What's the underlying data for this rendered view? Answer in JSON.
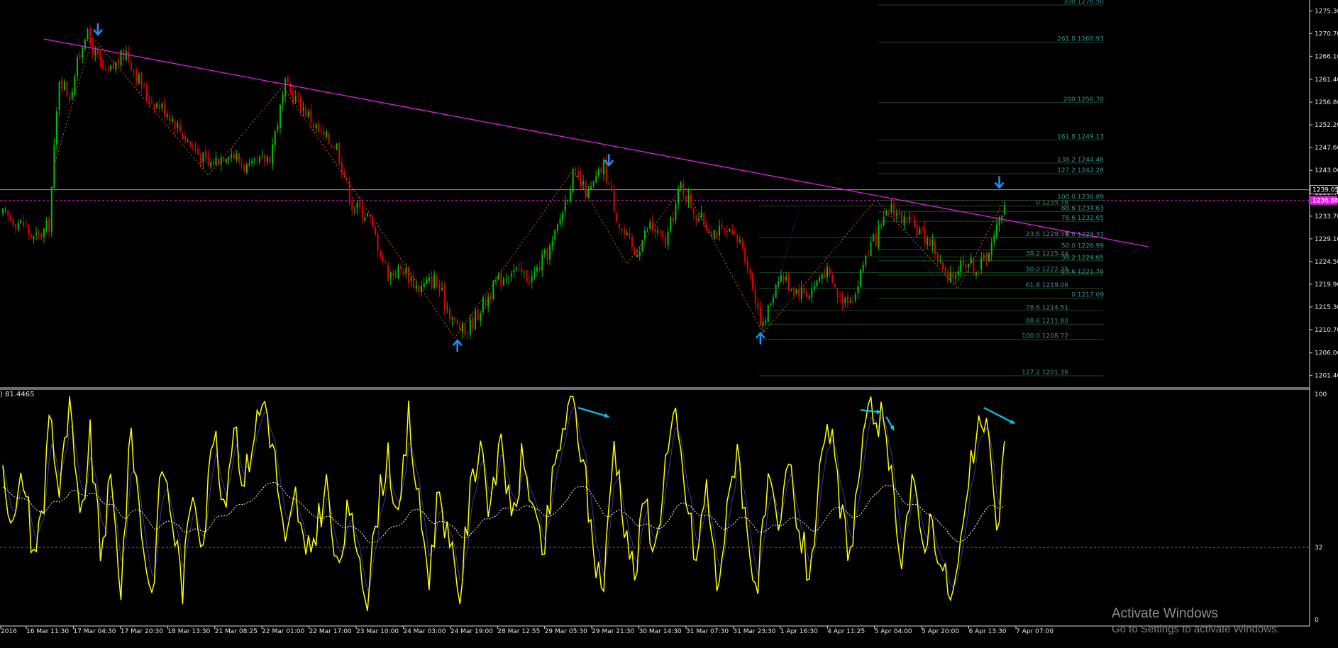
{
  "chart_data": {
    "type": "candlestick",
    "title": "",
    "price_axis": {
      "ticks": [
        "1275.30",
        "1270.70",
        "1266.10",
        "1261.40",
        "1256.80",
        "1252.20",
        "1247.60",
        "1243.00",
        "1238.40",
        "1233.70",
        "1229.10",
        "1224.50",
        "1219.90",
        "1215.30",
        "1210.70",
        "1206.00",
        "1201.40"
      ],
      "ylim": [
        1199.2,
        1277.5
      ],
      "current_price": "1239.05",
      "bid_marker": "1236.88",
      "bid_line": 1236.88,
      "current_line": 1239.05
    },
    "time_axis": {
      "labels": [
        "2016",
        "16 Mar 11:30",
        "17 Mar 04:30",
        "17 Mar 20:30",
        "18 Mar 13:30",
        "21 Mar 08:25",
        "22 Mar 01:00",
        "22 Mar 17:00",
        "23 Mar 10:00",
        "24 Mar 03:00",
        "24 Mar 19:00",
        "28 Mar 12:55",
        "29 Mar 05:30",
        "29 Mar 21:30",
        "30 Mar 14:30",
        "31 Mar 07:30",
        "31 Mar 23:30",
        "1 Apr 16:30",
        "4 Apr 11:25",
        "5 Apr 04:00",
        "5 Apr 20:00",
        "6 Apr 13:30",
        "7 Apr 07:00"
      ]
    },
    "price_swings": [
      {
        "i": 0,
        "p": 1234
      },
      {
        "i": 8,
        "p": 1232
      },
      {
        "i": 12,
        "p": 1229
      },
      {
        "i": 15,
        "p": 1230
      },
      {
        "i": 18,
        "p": 1232
      },
      {
        "i": 22,
        "p": 1262
      },
      {
        "i": 26,
        "p": 1258
      },
      {
        "i": 32,
        "p": 1271
      },
      {
        "i": 40,
        "p": 1262
      },
      {
        "i": 48,
        "p": 1267
      },
      {
        "i": 56,
        "p": 1258
      },
      {
        "i": 64,
        "p": 1255
      },
      {
        "i": 72,
        "p": 1249
      },
      {
        "i": 80,
        "p": 1244
      },
      {
        "i": 88,
        "p": 1247
      },
      {
        "i": 96,
        "p": 1243
      },
      {
        "i": 104,
        "p": 1246
      },
      {
        "i": 110,
        "p": 1260
      },
      {
        "i": 118,
        "p": 1255
      },
      {
        "i": 124,
        "p": 1250
      },
      {
        "i": 130,
        "p": 1248
      },
      {
        "i": 136,
        "p": 1236
      },
      {
        "i": 142,
        "p": 1234
      },
      {
        "i": 150,
        "p": 1222
      },
      {
        "i": 156,
        "p": 1223
      },
      {
        "i": 162,
        "p": 1219
      },
      {
        "i": 168,
        "p": 1221
      },
      {
        "i": 176,
        "p": 1212
      },
      {
        "i": 180,
        "p": 1210
      },
      {
        "i": 186,
        "p": 1215
      },
      {
        "i": 192,
        "p": 1220
      },
      {
        "i": 198,
        "p": 1223
      },
      {
        "i": 206,
        "p": 1221
      },
      {
        "i": 214,
        "p": 1228
      },
      {
        "i": 222,
        "p": 1242
      },
      {
        "i": 228,
        "p": 1238
      },
      {
        "i": 234,
        "p": 1244
      },
      {
        "i": 240,
        "p": 1232
      },
      {
        "i": 246,
        "p": 1226
      },
      {
        "i": 252,
        "p": 1232
      },
      {
        "i": 258,
        "p": 1228
      },
      {
        "i": 264,
        "p": 1240
      },
      {
        "i": 270,
        "p": 1234
      },
      {
        "i": 276,
        "p": 1231
      },
      {
        "i": 282,
        "p": 1230
      },
      {
        "i": 288,
        "p": 1228
      },
      {
        "i": 296,
        "p": 1211
      },
      {
        "i": 302,
        "p": 1222
      },
      {
        "i": 308,
        "p": 1219
      },
      {
        "i": 314,
        "p": 1218
      },
      {
        "i": 320,
        "p": 1223
      },
      {
        "i": 326,
        "p": 1217
      },
      {
        "i": 332,
        "p": 1218
      },
      {
        "i": 336,
        "p": 1226
      },
      {
        "i": 342,
        "p": 1231
      },
      {
        "i": 346,
        "p": 1236
      },
      {
        "i": 350,
        "p": 1233
      },
      {
        "i": 356,
        "p": 1231
      },
      {
        "i": 362,
        "p": 1228
      },
      {
        "i": 368,
        "p": 1220
      },
      {
        "i": 374,
        "p": 1225
      },
      {
        "i": 380,
        "p": 1223
      },
      {
        "i": 386,
        "p": 1229
      },
      {
        "i": 390,
        "p": 1237
      }
    ],
    "bar_count": 391,
    "trendline": {
      "from": {
        "i": 16,
        "p": 1269.6
      },
      "to": {
        "i": 446,
        "p": 1227.5
      },
      "color": "#e020e0"
    },
    "zigzag": [
      {
        "i": 20,
        "p": 1244
      },
      {
        "i": 35,
        "p": 1270
      },
      {
        "i": 80,
        "p": 1242
      },
      {
        "i": 109,
        "p": 1260
      },
      {
        "i": 176,
        "p": 1209
      },
      {
        "i": 222,
        "p": 1243
      },
      {
        "i": 243,
        "p": 1224
      },
      {
        "i": 265,
        "p": 1240
      },
      {
        "i": 296,
        "p": 1210
      },
      {
        "i": 340,
        "p": 1237
      },
      {
        "i": 372,
        "p": 1219
      },
      {
        "i": 390,
        "p": 1237
      }
    ],
    "arrows": [
      {
        "i": 37,
        "p": 1271.5,
        "dir": "down"
      },
      {
        "i": 177,
        "p": 1207.5,
        "dir": "up"
      },
      {
        "i": 236,
        "p": 1245,
        "dir": "down"
      },
      {
        "i": 295,
        "p": 1209,
        "dir": "up"
      },
      {
        "i": 388,
        "p": 1240.5,
        "dir": "down"
      }
    ],
    "fib_set_a": [
      {
        "label": "100.0  1208.72",
        "p": 1208.72
      },
      {
        "label": "88.6  1211.80",
        "p": 1211.8
      },
      {
        "label": "78.6  1214.51",
        "p": 1214.51
      },
      {
        "label": "61.8  1219.06",
        "p": 1219.06
      },
      {
        "label": "50.0  1222.25",
        "p": 1222.25
      },
      {
        "label": "38.2  1225.44",
        "p": 1225.44
      },
      {
        "label": "23.6  1229.39",
        "p": 1229.39
      },
      {
        "label": "0  1235.78",
        "p": 1235.78
      },
      {
        "label": "127.2  1201.36",
        "p": 1201.36
      }
    ],
    "fib_set_b": [
      {
        "label": "300  1276.50",
        "p": 1276.5
      },
      {
        "label": "261.8  1268.93",
        "p": 1268.93
      },
      {
        "label": "200  1256.70",
        "p": 1256.7
      },
      {
        "label": "161.8  1249.13",
        "p": 1249.13
      },
      {
        "label": "138.2  1244.46",
        "p": 1244.46
      },
      {
        "label": "127.2  1242.28",
        "p": 1242.28
      },
      {
        "label": "100.0  1236.89",
        "p": 1236.89
      },
      {
        "label": "88.6  1234.63",
        "p": 1234.63
      },
      {
        "label": "78.6  1232.65",
        "p": 1232.65
      },
      {
        "label": "8.6  1229.33",
        "p": 1229.33
      },
      {
        "label": "50.0  1226.99",
        "p": 1226.99
      },
      {
        "label": "38.2  1224.65",
        "p": 1224.65
      },
      {
        "label": "23.6  1221.76",
        "p": 1221.76
      },
      {
        "label": "0  1217.09",
        "p": 1217.09
      }
    ],
    "oscillator": {
      "label": ") 81.4465",
      "ylim": [
        0,
        100
      ],
      "ticks": [
        "100",
        "32",
        "0"
      ],
      "level_line": 32,
      "swings": [
        {
          "i": 0,
          "v": 70
        },
        {
          "i": 4,
          "v": 40
        },
        {
          "i": 8,
          "v": 65
        },
        {
          "i": 12,
          "v": 30
        },
        {
          "i": 16,
          "v": 50
        },
        {
          "i": 18,
          "v": 97
        },
        {
          "i": 22,
          "v": 55
        },
        {
          "i": 26,
          "v": 95
        },
        {
          "i": 30,
          "v": 40
        },
        {
          "i": 34,
          "v": 80
        },
        {
          "i": 38,
          "v": 30
        },
        {
          "i": 42,
          "v": 60
        },
        {
          "i": 46,
          "v": 15
        },
        {
          "i": 50,
          "v": 85
        },
        {
          "i": 54,
          "v": 40
        },
        {
          "i": 58,
          "v": 10
        },
        {
          "i": 62,
          "v": 70
        },
        {
          "i": 66,
          "v": 45
        },
        {
          "i": 70,
          "v": 15
        },
        {
          "i": 74,
          "v": 60
        },
        {
          "i": 78,
          "v": 35
        },
        {
          "i": 82,
          "v": 85
        },
        {
          "i": 86,
          "v": 45
        },
        {
          "i": 90,
          "v": 90
        },
        {
          "i": 94,
          "v": 60
        },
        {
          "i": 98,
          "v": 85
        },
        {
          "i": 102,
          "v": 98
        },
        {
          "i": 106,
          "v": 70
        },
        {
          "i": 110,
          "v": 30
        },
        {
          "i": 114,
          "v": 55
        },
        {
          "i": 118,
          "v": 25
        },
        {
          "i": 122,
          "v": 40
        },
        {
          "i": 126,
          "v": 60
        },
        {
          "i": 130,
          "v": 20
        },
        {
          "i": 134,
          "v": 45
        },
        {
          "i": 138,
          "v": 35
        },
        {
          "i": 142,
          "v": 10
        },
        {
          "i": 146,
          "v": 50
        },
        {
          "i": 150,
          "v": 75
        },
        {
          "i": 154,
          "v": 40
        },
        {
          "i": 158,
          "v": 90
        },
        {
          "i": 162,
          "v": 50
        },
        {
          "i": 166,
          "v": 20
        },
        {
          "i": 170,
          "v": 60
        },
        {
          "i": 174,
          "v": 30
        },
        {
          "i": 178,
          "v": 12
        },
        {
          "i": 182,
          "v": 55
        },
        {
          "i": 186,
          "v": 82
        },
        {
          "i": 190,
          "v": 45
        },
        {
          "i": 194,
          "v": 85
        },
        {
          "i": 198,
          "v": 40
        },
        {
          "i": 202,
          "v": 70
        },
        {
          "i": 206,
          "v": 55
        },
        {
          "i": 210,
          "v": 25
        },
        {
          "i": 214,
          "v": 60
        },
        {
          "i": 218,
          "v": 85
        },
        {
          "i": 222,
          "v": 96
        },
        {
          "i": 226,
          "v": 70
        },
        {
          "i": 230,
          "v": 30
        },
        {
          "i": 234,
          "v": 15
        },
        {
          "i": 238,
          "v": 80
        },
        {
          "i": 242,
          "v": 45
        },
        {
          "i": 246,
          "v": 18
        },
        {
          "i": 250,
          "v": 55
        },
        {
          "i": 254,
          "v": 30
        },
        {
          "i": 258,
          "v": 70
        },
        {
          "i": 262,
          "v": 88
        },
        {
          "i": 266,
          "v": 55
        },
        {
          "i": 270,
          "v": 25
        },
        {
          "i": 274,
          "v": 60
        },
        {
          "i": 278,
          "v": 15
        },
        {
          "i": 282,
          "v": 45
        },
        {
          "i": 286,
          "v": 80
        },
        {
          "i": 290,
          "v": 35
        },
        {
          "i": 294,
          "v": 15
        },
        {
          "i": 298,
          "v": 60
        },
        {
          "i": 302,
          "v": 35
        },
        {
          "i": 306,
          "v": 70
        },
        {
          "i": 310,
          "v": 40
        },
        {
          "i": 314,
          "v": 20
        },
        {
          "i": 318,
          "v": 60
        },
        {
          "i": 322,
          "v": 85
        },
        {
          "i": 326,
          "v": 50
        },
        {
          "i": 330,
          "v": 30
        },
        {
          "i": 334,
          "v": 70
        },
        {
          "i": 338,
          "v": 92
        },
        {
          "i": 342,
          "v": 88
        },
        {
          "i": 346,
          "v": 60
        },
        {
          "i": 350,
          "v": 30
        },
        {
          "i": 354,
          "v": 60
        },
        {
          "i": 358,
          "v": 35
        },
        {
          "i": 362,
          "v": 45
        },
        {
          "i": 366,
          "v": 20
        },
        {
          "i": 370,
          "v": 10
        },
        {
          "i": 374,
          "v": 40
        },
        {
          "i": 378,
          "v": 75
        },
        {
          "i": 382,
          "v": 90
        },
        {
          "i": 386,
          "v": 55
        },
        {
          "i": 388,
          "v": 40
        },
        {
          "i": 390,
          "v": 85
        }
      ],
      "divergence_arrows": [
        {
          "i1": 224,
          "v1": 94,
          "i2": 236,
          "v2": 90
        },
        {
          "i1": 334,
          "v1": 93,
          "i2": 342,
          "v2": 92
        },
        {
          "i1": 344,
          "v1": 90,
          "i2": 347,
          "v2": 84
        },
        {
          "i1": 382,
          "v1": 94,
          "i2": 394,
          "v2": 87
        }
      ]
    },
    "colors": {
      "bull": "#00c000",
      "bear": "#e00000",
      "trend": "#e020e0",
      "arrow": "#1e90ff",
      "fib": "#1d3b1d",
      "oscillator": "#ffff00",
      "osc_signal": "#3a3aa0",
      "divergence": "#00c8f0"
    }
  },
  "watermark": {
    "title": "Activate Windows",
    "subtitle": "Go to Settings to activate Windows."
  }
}
